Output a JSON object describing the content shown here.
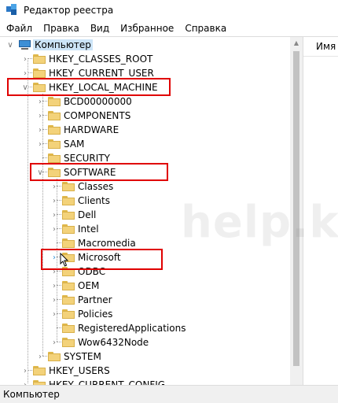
{
  "window": {
    "title": "Редактор реестра"
  },
  "menu": [
    "Файл",
    "Правка",
    "Вид",
    "Избранное",
    "Справка"
  ],
  "list_header": {
    "name_col": "Имя"
  },
  "tree": {
    "root": "Компьютер",
    "hives": [
      "HKEY_CLASSES_ROOT",
      "HKEY_CURRENT_USER",
      "HKEY_LOCAL_MACHINE",
      "HKEY_USERS",
      "HKEY_CURRENT_CONFIG"
    ],
    "hklm_children": [
      "BCD00000000",
      "COMPONENTS",
      "HARDWARE",
      "SAM",
      "SECURITY",
      "SOFTWARE",
      "SYSTEM"
    ],
    "software_children": [
      "Classes",
      "Clients",
      "Dell",
      "Intel",
      "Macromedia",
      "Microsoft",
      "ODBC",
      "OEM",
      "Partner",
      "Policies",
      "RegisteredApplications",
      "Wow6432Node"
    ]
  },
  "status": {
    "path": "Компьютер"
  },
  "watermark": "help.kz",
  "colors": {
    "highlight": "#e00000",
    "folder": "#f3d27a",
    "selection": "#cce4f7"
  }
}
